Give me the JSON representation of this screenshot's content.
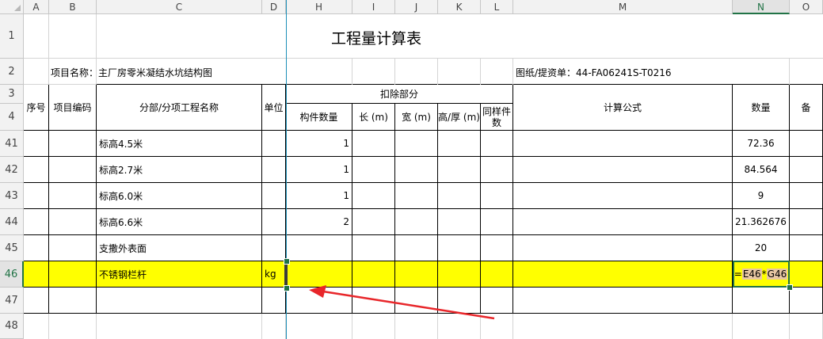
{
  "columns": [
    "A",
    "B",
    "C",
    "D",
    "H",
    "I",
    "J",
    "K",
    "L",
    "M",
    "N",
    "O"
  ],
  "selected_column": "N",
  "rows": [
    "1",
    "2",
    "3",
    "4",
    "41",
    "42",
    "43",
    "44",
    "45",
    "46",
    "47",
    "48"
  ],
  "selected_row": "46",
  "sheet_title": "工程量计算表",
  "project_label": "项目名称：主厂房零米凝结水坑结构图",
  "drawing_label": "图纸/提资单：44-FA06241S-T0216",
  "headers": {
    "seq": "序号",
    "code": "项目编码",
    "name": "分部/分项工程名称",
    "unit": "单位",
    "deduct": "扣除部分",
    "count": "构件数量",
    "length": "长 (m)",
    "width": "宽 (m)",
    "height": "高/厚 (m)",
    "same": "同样件数",
    "formula": "计算公式",
    "qty": "数量",
    "note": "备"
  },
  "data_rows": [
    {
      "row": "41",
      "name": "标高4.5米",
      "count": "1",
      "qty": "72.36"
    },
    {
      "row": "42",
      "name": "标高2.7米",
      "count": "1",
      "qty": "84.564"
    },
    {
      "row": "43",
      "name": "标高6.0米",
      "count": "1",
      "qty": "9"
    },
    {
      "row": "44",
      "name": "标高6.6米",
      "count": "2",
      "qty": "21.362676"
    },
    {
      "row": "45",
      "name": "支撒外表面",
      "count": "",
      "qty": "20"
    },
    {
      "row": "46",
      "name": "不锈钢栏杆",
      "unit": "kg",
      "count": "",
      "qty_formula": {
        "eq": "=",
        "ref1": "E46",
        "op": "*",
        "ref2": "G46"
      }
    },
    {
      "row": "47",
      "name": "",
      "count": "",
      "qty": ""
    }
  ],
  "colors": {
    "highlight": "#ffff00",
    "selection": "#217346",
    "arrow": "#e8262a",
    "freeze_line": "#1c8fb8"
  }
}
